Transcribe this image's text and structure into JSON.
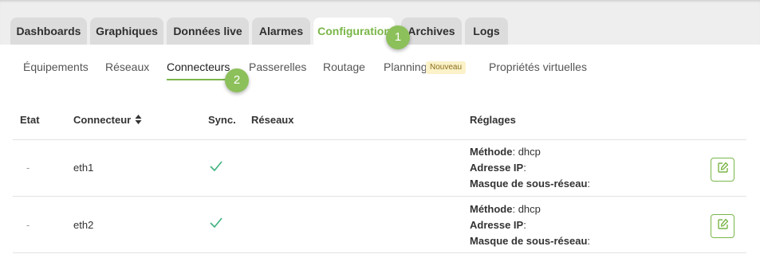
{
  "main_tabs": [
    {
      "label": "Dashboards"
    },
    {
      "label": "Graphiques"
    },
    {
      "label": "Données live"
    },
    {
      "label": "Alarmes"
    },
    {
      "label": "Configuration",
      "active": true
    },
    {
      "label": "Archives"
    },
    {
      "label": "Logs"
    }
  ],
  "sub_tabs": [
    {
      "label": "Équipements"
    },
    {
      "label": "Réseaux"
    },
    {
      "label": "Connecteurs",
      "active": true
    },
    {
      "label": "Passerelles"
    },
    {
      "label": "Routage"
    },
    {
      "label": "Planning",
      "badge": "Nouveau"
    },
    {
      "label": "Propriétés virtuelles"
    }
  ],
  "markers": [
    "1",
    "2"
  ],
  "table": {
    "headers": {
      "etat": "Etat",
      "connecteur": "Connecteur",
      "sync": "Sync.",
      "reseaux": "Réseaux",
      "reglages": "Réglages"
    },
    "rows": [
      {
        "etat": "-",
        "connecteur": "eth1",
        "sync": "check",
        "methode_label": "Méthode",
        "methode_value": "dhcp",
        "ip_label": "Adresse IP",
        "masque_label": "Masque de sous-réseau"
      },
      {
        "etat": "-",
        "connecteur": "eth2",
        "sync": "check",
        "methode_label": "Méthode",
        "methode_value": "dhcp",
        "ip_label": "Adresse IP",
        "masque_label": "Masque de sous-réseau"
      }
    ]
  },
  "colors": {
    "accent": "#7ab648",
    "marker": "#8cc05a",
    "badge_bg": "#fbf2c9"
  }
}
